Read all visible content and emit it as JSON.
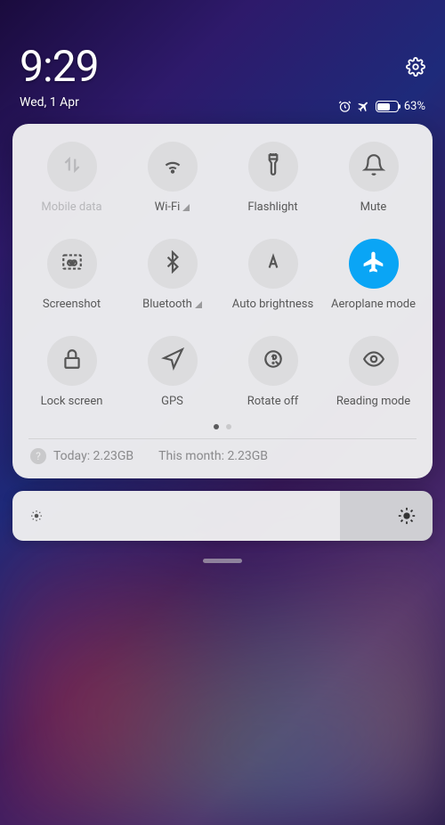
{
  "status": {
    "time": "9:29",
    "date": "Wed, 1 Apr",
    "battery_percent": "63%",
    "battery_level": 63
  },
  "tiles": [
    {
      "label": "Mobile data",
      "icon": "mobile-data",
      "active": false,
      "disabled": true,
      "expandable": false
    },
    {
      "label": "Wi-Fi",
      "icon": "wifi",
      "active": false,
      "disabled": false,
      "expandable": true
    },
    {
      "label": "Flashlight",
      "icon": "flashlight",
      "active": false,
      "disabled": false,
      "expandable": false
    },
    {
      "label": "Mute",
      "icon": "bell",
      "active": false,
      "disabled": false,
      "expandable": false
    },
    {
      "label": "Screenshot",
      "icon": "screenshot",
      "active": false,
      "disabled": false,
      "expandable": false
    },
    {
      "label": "Bluetooth",
      "icon": "bluetooth",
      "active": false,
      "disabled": false,
      "expandable": true
    },
    {
      "label": "Auto brightness",
      "icon": "auto-brightness",
      "active": false,
      "disabled": false,
      "expandable": false
    },
    {
      "label": "Aeroplane mode",
      "icon": "airplane",
      "active": true,
      "disabled": false,
      "expandable": false
    },
    {
      "label": "Lock screen",
      "icon": "lock",
      "active": false,
      "disabled": false,
      "expandable": false
    },
    {
      "label": "GPS",
      "icon": "gps",
      "active": false,
      "disabled": false,
      "expandable": false
    },
    {
      "label": "Rotate off",
      "icon": "rotate-off",
      "active": false,
      "disabled": false,
      "expandable": false
    },
    {
      "label": "Reading mode",
      "icon": "eye",
      "active": false,
      "disabled": false,
      "expandable": false
    }
  ],
  "pagination": {
    "pages": 2,
    "current": 0
  },
  "data_usage": {
    "today_label": "Today: 2.23GB",
    "month_label": "This month: 2.23GB"
  },
  "brightness": {
    "level": 78
  }
}
